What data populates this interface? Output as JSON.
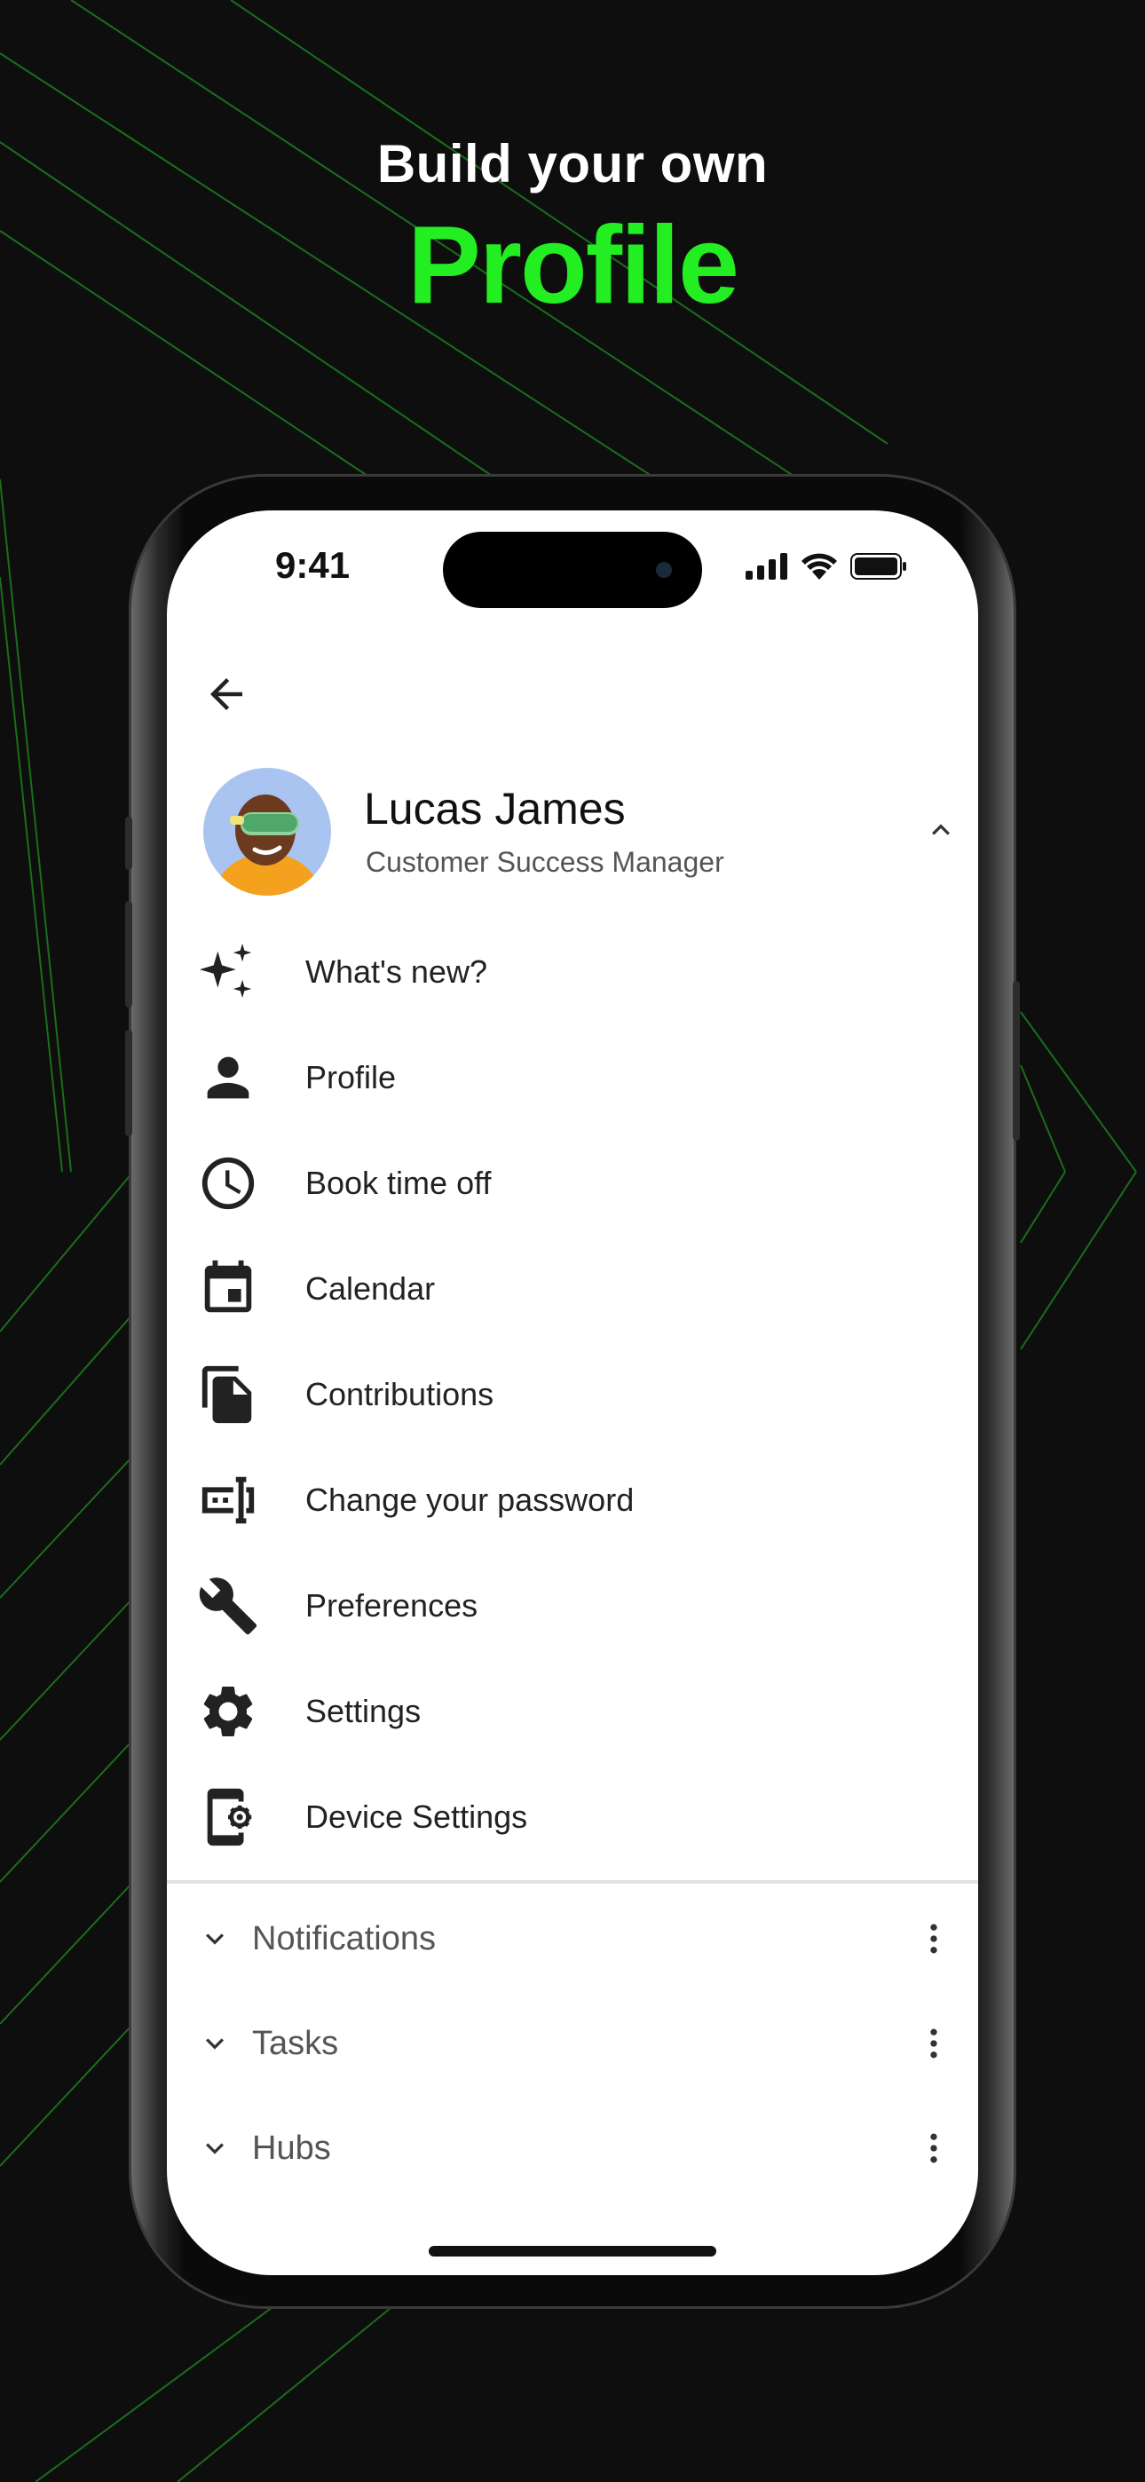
{
  "headline": {
    "sub": "Build your own",
    "main": "Profile"
  },
  "colors": {
    "accent": "#22ee22",
    "background": "#0e0e0e"
  },
  "status_bar": {
    "time": "9:41",
    "icons": [
      "signal-icon",
      "wifi-icon",
      "battery-icon"
    ]
  },
  "header": {
    "back_icon": "arrow-left-icon"
  },
  "user": {
    "name": "Lucas James",
    "role": "Customer Success Manager",
    "collapse_icon": "chevron-up-icon"
  },
  "menu": {
    "items": [
      {
        "label": "What's new?",
        "icon": "sparkles-icon"
      },
      {
        "label": "Profile",
        "icon": "person-icon"
      },
      {
        "label": "Book time off",
        "icon": "clock-icon"
      },
      {
        "label": "Calendar",
        "icon": "calendar-icon"
      },
      {
        "label": "Contributions",
        "icon": "documents-icon"
      },
      {
        "label": "Change your password",
        "icon": "password-icon"
      },
      {
        "label": "Preferences",
        "icon": "wrench-icon"
      },
      {
        "label": "Settings",
        "icon": "gear-icon"
      },
      {
        "label": "Device Settings",
        "icon": "device-settings-icon"
      }
    ]
  },
  "sections": [
    {
      "label": "Notifications"
    },
    {
      "label": "Tasks"
    },
    {
      "label": "Hubs"
    }
  ]
}
